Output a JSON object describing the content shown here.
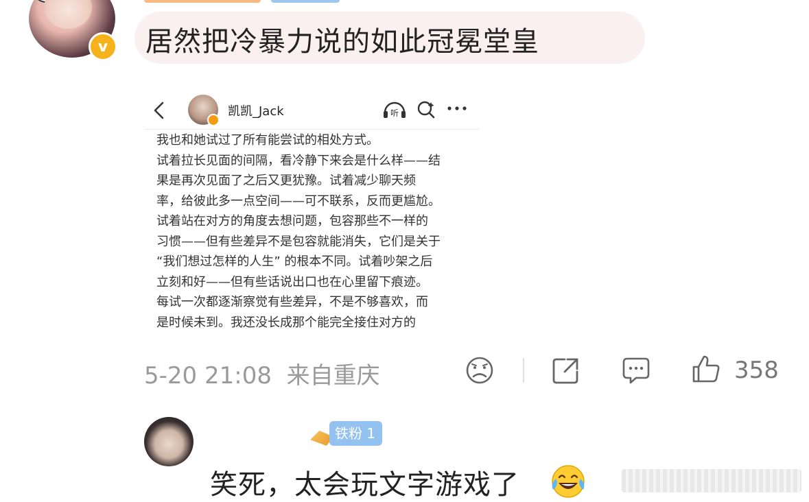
{
  "top_comment": {
    "text": "居然把冷暴力说的如此冠冕堂皇",
    "verified_mark": "v"
  },
  "screenshot": {
    "username": "凯凯_Jack",
    "paragraph_lines": [
      "我也和她试过了所有能尝试的相处方式。",
      "试着拉长见面的间隔，看冷静下来会是什么样——结",
      "果是再次见面了之后又更犹豫。试着减少聊天频",
      "率，给彼此多一点空间——可不联系，反而更尴尬。",
      "试着站在对方的角度去想问题，包容那些不一样的",
      "习惯——但有些差异不是包容就能消失，它们是关于",
      "“我们想过怎样的人生” 的根本不同。试着吵架之后",
      "立刻和好——但有些话说出口也在心里留下痕迹。",
      "每试一次都逐渐察觉有些差异，不是不够喜欢，而",
      "是时候未到。我还没长成那个能完全接住对方的"
    ],
    "icons": [
      "back-icon",
      "listen-icon",
      "search-icon",
      "more-icon"
    ]
  },
  "meta": {
    "timestamp": "5-20 21:08",
    "location": "来自重庆",
    "like_count": "358",
    "icons": [
      "sad-face-icon",
      "share-icon",
      "comment-icon",
      "like-icon"
    ]
  },
  "reply": {
    "fan_badge": "铁粉 1",
    "text": "笑死，太会玩文字游戏了",
    "emoji": "tears-of-joy-emoji"
  }
}
